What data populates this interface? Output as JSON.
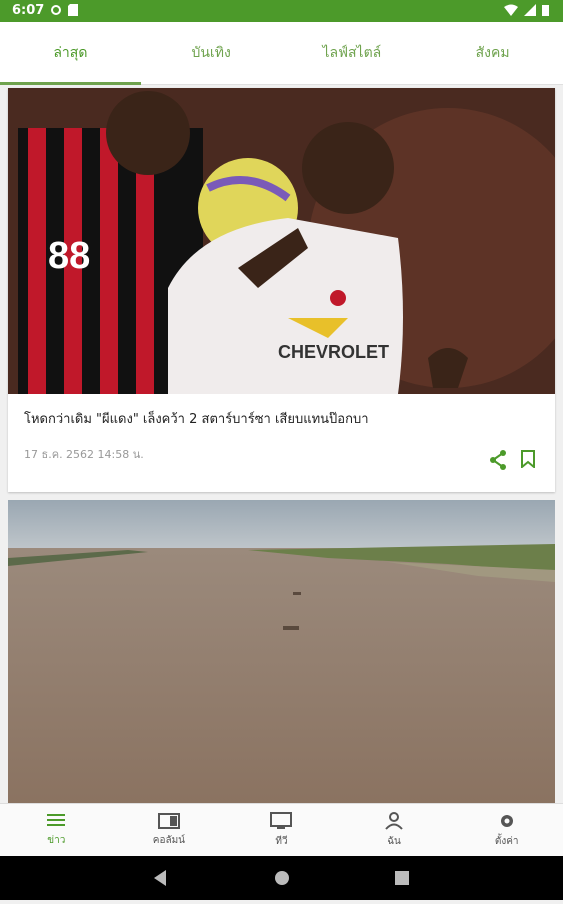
{
  "status": {
    "time": "6:07"
  },
  "tabs": [
    {
      "label": "ล่าสุด"
    },
    {
      "label": "บันเทิง"
    },
    {
      "label": "ไลฟ์สไตล์"
    },
    {
      "label": "สังคม"
    }
  ],
  "articles": [
    {
      "headline": "โหดกว่าเดิม \"ผีแดง\" เล็งคว้า 2 สตาร์บาร์ซา เสียบแทนป๊อกบา",
      "timestamp": "17 ธ.ค. 2562 14:58 น.",
      "jersey": {
        "number": "88",
        "sponsor": "CHEVROLET"
      }
    },
    {}
  ],
  "bottom_nav": [
    {
      "label": "ข่าว"
    },
    {
      "label": "คอลัมน์"
    },
    {
      "label": "ทีวี"
    },
    {
      "label": "ฉัน"
    },
    {
      "label": "ตั้งค่า"
    }
  ],
  "colors": {
    "accent": "#4c9a2a",
    "status_bar": "#4c9a2a"
  }
}
